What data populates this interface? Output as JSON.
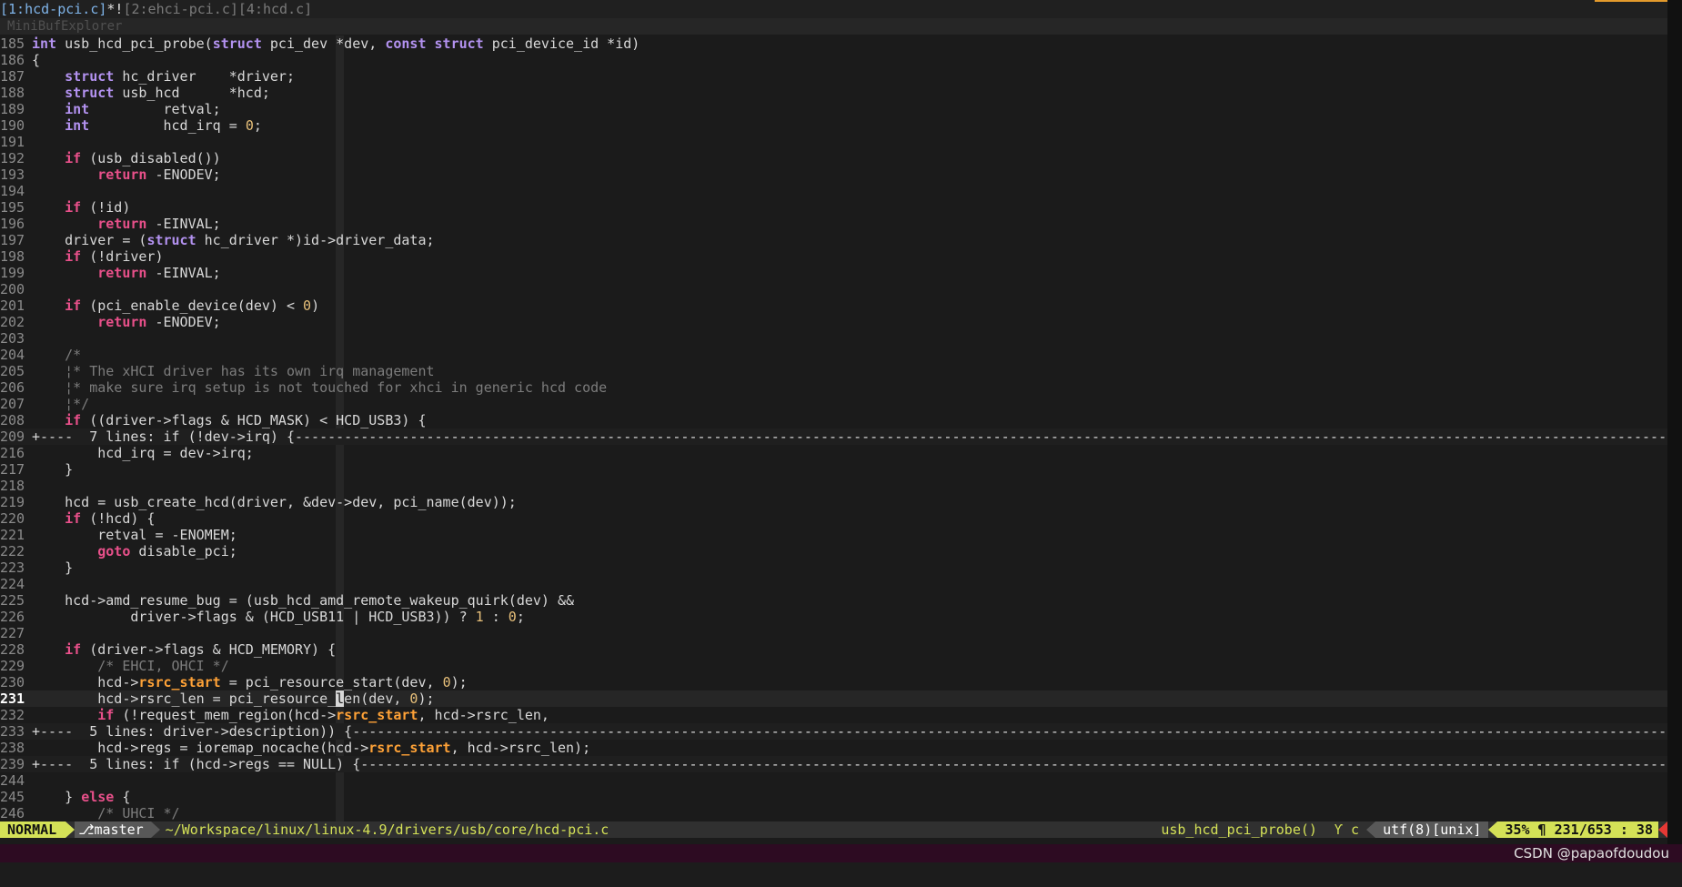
{
  "tabline": {
    "active": "[1:hcd-pci.c]",
    "modified": "*!",
    "others": "[2:ehci-pci.c][4:hcd.c]"
  },
  "minibuf": {
    "label": "MiniBufExplorer"
  },
  "editor": {
    "lines": [
      {
        "n": "185",
        "t": "code",
        "s": [
          [
            "ty",
            "int"
          ],
          [
            "p",
            " usb_hcd_pci_probe("
          ],
          [
            "ty",
            "struct"
          ],
          [
            "p",
            " pci_dev *dev, "
          ],
          [
            "ty",
            "const"
          ],
          [
            "p",
            " "
          ],
          [
            "ty",
            "struct"
          ],
          [
            "p",
            " pci_device_id *id)"
          ]
        ]
      },
      {
        "n": "186",
        "t": "code",
        "s": [
          [
            "p",
            "{"
          ]
        ]
      },
      {
        "n": "187",
        "t": "code",
        "s": [
          [
            "p",
            "    "
          ],
          [
            "ty",
            "struct"
          ],
          [
            "p",
            " hc_driver    *driver;"
          ]
        ]
      },
      {
        "n": "188",
        "t": "code",
        "s": [
          [
            "p",
            "    "
          ],
          [
            "ty",
            "struct"
          ],
          [
            "p",
            " usb_hcd      *hcd;"
          ]
        ]
      },
      {
        "n": "189",
        "t": "code",
        "s": [
          [
            "p",
            "    "
          ],
          [
            "ty",
            "int"
          ],
          [
            "p",
            "         retval;"
          ]
        ]
      },
      {
        "n": "190",
        "t": "code",
        "s": [
          [
            "p",
            "    "
          ],
          [
            "ty",
            "int"
          ],
          [
            "p",
            "         hcd_irq = "
          ],
          [
            "num",
            "0"
          ],
          [
            "p",
            ";"
          ]
        ]
      },
      {
        "n": "191",
        "t": "code",
        "s": []
      },
      {
        "n": "192",
        "t": "code",
        "s": [
          [
            "p",
            "    "
          ],
          [
            "kw",
            "if"
          ],
          [
            "p",
            " (usb_disabled())"
          ]
        ]
      },
      {
        "n": "193",
        "t": "code",
        "s": [
          [
            "p",
            "        "
          ],
          [
            "kw",
            "return"
          ],
          [
            "p",
            " -ENODEV;"
          ]
        ]
      },
      {
        "n": "194",
        "t": "code",
        "s": []
      },
      {
        "n": "195",
        "t": "code",
        "s": [
          [
            "p",
            "    "
          ],
          [
            "kw",
            "if"
          ],
          [
            "p",
            " (!id)"
          ]
        ]
      },
      {
        "n": "196",
        "t": "code",
        "s": [
          [
            "p",
            "        "
          ],
          [
            "kw",
            "return"
          ],
          [
            "p",
            " -EINVAL;"
          ]
        ]
      },
      {
        "n": "197",
        "t": "code",
        "s": [
          [
            "p",
            "    driver = ("
          ],
          [
            "ty",
            "struct"
          ],
          [
            "p",
            " hc_driver *)id->driver_data;"
          ]
        ]
      },
      {
        "n": "198",
        "t": "code",
        "s": [
          [
            "p",
            "    "
          ],
          [
            "kw",
            "if"
          ],
          [
            "p",
            " (!driver)"
          ]
        ]
      },
      {
        "n": "199",
        "t": "code",
        "s": [
          [
            "p",
            "        "
          ],
          [
            "kw",
            "return"
          ],
          [
            "p",
            " -EINVAL;"
          ]
        ]
      },
      {
        "n": "200",
        "t": "code",
        "s": []
      },
      {
        "n": "201",
        "t": "code",
        "s": [
          [
            "p",
            "    "
          ],
          [
            "kw",
            "if"
          ],
          [
            "p",
            " (pci_enable_device(dev) < "
          ],
          [
            "num",
            "0"
          ],
          [
            "p",
            ")"
          ]
        ]
      },
      {
        "n": "202",
        "t": "code",
        "s": [
          [
            "p",
            "        "
          ],
          [
            "kw",
            "return"
          ],
          [
            "p",
            " -ENODEV;"
          ]
        ]
      },
      {
        "n": "203",
        "t": "code",
        "s": []
      },
      {
        "n": "204",
        "t": "code",
        "s": [
          [
            "p",
            "    "
          ],
          [
            "cm",
            "/*"
          ]
        ]
      },
      {
        "n": "205",
        "t": "code",
        "s": [
          [
            "p",
            "    "
          ],
          [
            "cm",
            "¦* The xHCI driver has its own irq management"
          ]
        ]
      },
      {
        "n": "206",
        "t": "code",
        "s": [
          [
            "p",
            "    "
          ],
          [
            "cm",
            "¦* make sure irq setup is not touched for xhci in generic hcd code"
          ]
        ]
      },
      {
        "n": "207",
        "t": "code",
        "s": [
          [
            "p",
            "    "
          ],
          [
            "cm",
            "¦*/"
          ]
        ]
      },
      {
        "n": "208",
        "t": "code",
        "s": [
          [
            "p",
            "    "
          ],
          [
            "kw",
            "if"
          ],
          [
            "p",
            " ((driver->flags & HCD_MASK) < HCD_USB3) {"
          ]
        ]
      },
      {
        "n": "209",
        "t": "fold",
        "s": [
          [
            "p",
            "+----  7 lines: if (!dev->irq) {-----------------------------------------------------------------------------------------------------------------------------------------------------------------------------------------------------------------------------------------------------------------------"
          ]
        ]
      },
      {
        "n": "216",
        "t": "code",
        "s": [
          [
            "p",
            "        hcd_irq = dev->irq;"
          ]
        ]
      },
      {
        "n": "217",
        "t": "code",
        "s": [
          [
            "p",
            "    }"
          ]
        ]
      },
      {
        "n": "218",
        "t": "code",
        "s": []
      },
      {
        "n": "219",
        "t": "code",
        "s": [
          [
            "p",
            "    hcd = usb_create_hcd(driver, &dev->dev, pci_name(dev));"
          ]
        ]
      },
      {
        "n": "220",
        "t": "code",
        "s": [
          [
            "p",
            "    "
          ],
          [
            "kw",
            "if"
          ],
          [
            "p",
            " (!hcd) {"
          ]
        ]
      },
      {
        "n": "221",
        "t": "code",
        "s": [
          [
            "p",
            "        retval = -ENOMEM;"
          ]
        ]
      },
      {
        "n": "222",
        "t": "code",
        "s": [
          [
            "p",
            "        "
          ],
          [
            "kw",
            "goto"
          ],
          [
            "p",
            " disable_pci;"
          ]
        ]
      },
      {
        "n": "223",
        "t": "code",
        "s": [
          [
            "p",
            "    }"
          ]
        ]
      },
      {
        "n": "224",
        "t": "code",
        "s": []
      },
      {
        "n": "225",
        "t": "code",
        "s": [
          [
            "p",
            "    hcd->amd_resume_bug = (usb_hcd_amd_remote_wakeup_quirk(dev) &&"
          ]
        ]
      },
      {
        "n": "226",
        "t": "code",
        "s": [
          [
            "p",
            "            driver->flags & (HCD_USB11 | HCD_USB3)) ? "
          ],
          [
            "num",
            "1"
          ],
          [
            "p",
            " : "
          ],
          [
            "num",
            "0"
          ],
          [
            "p",
            ";"
          ]
        ]
      },
      {
        "n": "227",
        "t": "code",
        "s": []
      },
      {
        "n": "228",
        "t": "code",
        "s": [
          [
            "p",
            "    "
          ],
          [
            "kw",
            "if"
          ],
          [
            "p",
            " (driver->flags & HCD_MEMORY) {"
          ]
        ]
      },
      {
        "n": "229",
        "t": "code",
        "s": [
          [
            "p",
            "        "
          ],
          [
            "cm",
            "/* EHCI, OHCI */"
          ]
        ]
      },
      {
        "n": "230",
        "t": "code",
        "s": [
          [
            "p",
            "        hcd->"
          ],
          [
            "var",
            "rsrc_start"
          ],
          [
            "p",
            " = pci_resource_start(dev, "
          ],
          [
            "num",
            "0"
          ],
          [
            "p",
            ");"
          ]
        ]
      },
      {
        "n": "231",
        "t": "cur",
        "s": [
          [
            "p",
            "        hcd->rsrc_len = pci_resource_"
          ],
          [
            "cur",
            "l"
          ],
          [
            "p",
            "en(dev, "
          ],
          [
            "num",
            "0"
          ],
          [
            "p",
            ");"
          ]
        ]
      },
      {
        "n": "232",
        "t": "code",
        "s": [
          [
            "p",
            "        "
          ],
          [
            "kw",
            "if"
          ],
          [
            "p",
            " (!request_mem_region(hcd->"
          ],
          [
            "var",
            "rsrc_start"
          ],
          [
            "p",
            ", hcd->rsrc_len,"
          ]
        ]
      },
      {
        "n": "233",
        "t": "fold",
        "s": [
          [
            "p",
            "+----  5 lines: driver->description)) {------------------------------------------------------------------------------------------------------------------------------------------------------------------------------------------------------------------------------------------------------------------"
          ]
        ]
      },
      {
        "n": "238",
        "t": "code",
        "s": [
          [
            "p",
            "        hcd->regs = ioremap_nocache(hcd->"
          ],
          [
            "var",
            "rsrc_start"
          ],
          [
            "p",
            ", hcd->rsrc_len);"
          ]
        ]
      },
      {
        "n": "239",
        "t": "fold",
        "s": [
          [
            "p",
            "+----  5 lines: if (hcd->regs == NULL) {-----------------------------------------------------------------------------------------------------------------------------------------------------------------------------------------------------------------------------------------------------------------"
          ]
        ]
      },
      {
        "n": "244",
        "t": "code",
        "s": []
      },
      {
        "n": "245",
        "t": "code",
        "s": [
          [
            "p",
            "    } "
          ],
          [
            "kw",
            "else"
          ],
          [
            "p",
            " {"
          ]
        ]
      },
      {
        "n": "246",
        "t": "code",
        "s": [
          [
            "p",
            "        "
          ],
          [
            "cm",
            "/* UHCI */"
          ]
        ]
      }
    ]
  },
  "statusline": {
    "mode": "NORMAL",
    "branch": "⎇master",
    "path": "~/Workspace/linux/linux-4.9/drivers/usb/core/hcd-pci.c",
    "function": "usb_hcd_pci_probe() ",
    "filetype": "Ƴ c",
    "encoding": "utf(8)[unix]",
    "position": "35% ¶ 231/653 : 38"
  },
  "watermark": "CSDN @papaofdoudou",
  "colors": {
    "keyword": "#e8508a",
    "type": "#b392f0",
    "number": "#e8c07a",
    "comment": "#7c7c7c",
    "highlight_var": "#ffa237",
    "statusline_accent": "#d4e157"
  }
}
